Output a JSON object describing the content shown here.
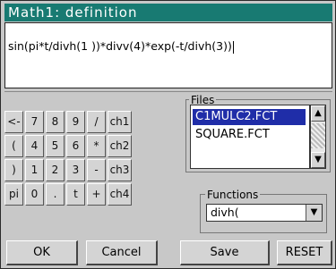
{
  "window": {
    "title": "Math1: definition"
  },
  "editor": {
    "text": "sin(pi*t/divh(1 ))*divv(4)*exp(-t/divh(3))"
  },
  "keypad": {
    "row1": [
      "<-",
      "7",
      "8",
      "9",
      "/",
      "ch1"
    ],
    "row2": [
      "(",
      "4",
      "5",
      "6",
      "*",
      "ch2"
    ],
    "row3": [
      ")",
      "1",
      "2",
      "3",
      "-",
      "ch3"
    ],
    "row4": [
      "pi",
      "0",
      ".",
      "t",
      "+",
      "ch4"
    ]
  },
  "files": {
    "label": "Files",
    "items": [
      "C1MULC2.FCT",
      "SQUARE.FCT"
    ],
    "selected_index": 0
  },
  "functions": {
    "label": "Functions",
    "selected": "divh("
  },
  "buttons": {
    "ok": "OK",
    "cancel": "Cancel",
    "save": "Save",
    "reset": "RESET"
  },
  "colors": {
    "title_bg": "#187a72",
    "selection": "#1f2da8",
    "window_bg": "#c8c8c8"
  }
}
